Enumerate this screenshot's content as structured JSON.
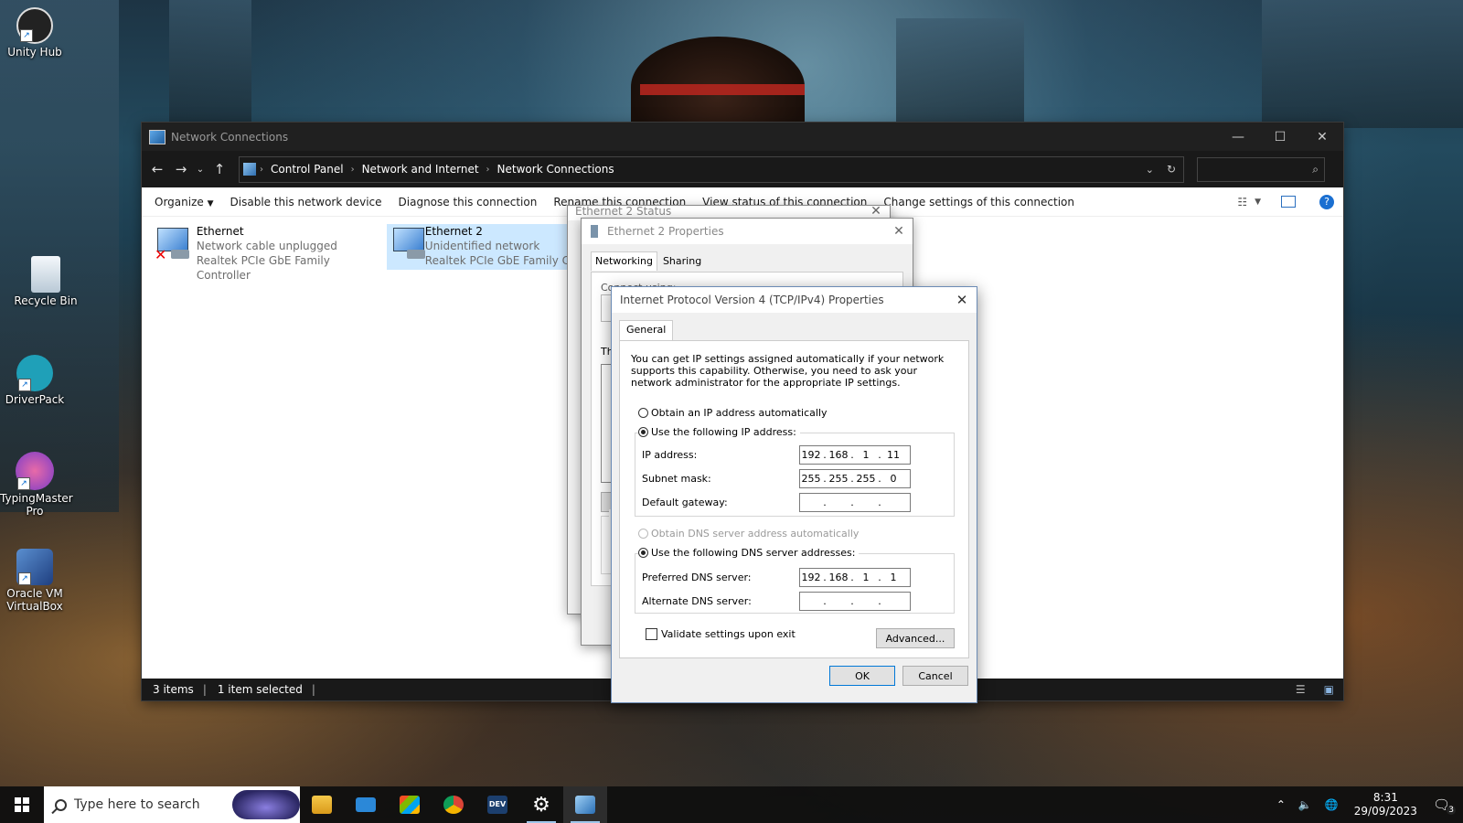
{
  "desktop": {
    "icons": [
      {
        "label": "Unity Hub"
      },
      {
        "label": "Recycle Bin"
      },
      {
        "label": "DriverPack"
      },
      {
        "label": "TypingMaster Pro"
      },
      {
        "label": "Oracle VM VirtualBox"
      }
    ]
  },
  "explorer": {
    "title": "Network Connections",
    "breadcrumb": [
      "Control Panel",
      "Network and Internet",
      "Network Connections"
    ],
    "commands": [
      "Organize",
      "Disable this network device",
      "Diagnose this connection",
      "Rename this connection",
      "View status of this connection",
      "Change settings of this connection"
    ],
    "items": [
      {
        "name": "Ethernet",
        "status": "Network cable unplugged",
        "adapter": "Realtek PCIe GbE Family Controller"
      },
      {
        "name": "Ethernet 2",
        "status": "Unidentified network",
        "adapter": "Realtek PCIe GbE Family C"
      }
    ],
    "status_bar": {
      "count": "3 items",
      "selected": "1 item selected"
    }
  },
  "status_dialog": {
    "title": "Ethernet 2 Status"
  },
  "properties_dialog": {
    "title": "Ethernet 2 Properties",
    "tabs": [
      "Networking",
      "Sharing"
    ],
    "connect_using_label": "Connect using:",
    "partial_text_1": "Th",
    "partial_text_2": "D"
  },
  "tcp_dialog": {
    "title": "Internet Protocol Version 4 (TCP/IPv4) Properties",
    "tab": "General",
    "description": "You can get IP settings assigned automatically if your network supports this capability. Otherwise, you need to ask your network administrator for the appropriate IP settings.",
    "ip_auto_label": "Obtain an IP address automatically",
    "ip_manual_label": "Use the following IP address:",
    "ip_mode": "manual",
    "fields": {
      "ip_address": {
        "label": "IP address:",
        "octets": [
          "192",
          "168",
          "1",
          "11"
        ]
      },
      "subnet_mask": {
        "label": "Subnet mask:",
        "octets": [
          "255",
          "255",
          "255",
          "0"
        ]
      },
      "default_gateway": {
        "label": "Default gateway:",
        "octets": [
          "",
          "",
          "",
          ""
        ]
      }
    },
    "dns_auto_label": "Obtain DNS server address automatically",
    "dns_manual_label": "Use the following DNS server addresses:",
    "dns_mode": "manual",
    "dns_fields": {
      "preferred": {
        "label": "Preferred DNS server:",
        "octets": [
          "192",
          "168",
          "1",
          "1"
        ]
      },
      "alternate": {
        "label": "Alternate DNS server:",
        "octets": [
          "",
          "",
          "",
          ""
        ]
      }
    },
    "validate_label": "Validate settings upon exit",
    "validate_checked": false,
    "advanced_label": "Advanced...",
    "ok_label": "OK",
    "cancel_label": "Cancel"
  },
  "taskbar": {
    "search_placeholder": "Type here to search",
    "apps": [
      "file-explorer",
      "mail",
      "microsoft-store",
      "chrome",
      "dev-home",
      "settings",
      "network-connections"
    ],
    "dev_label": "DEV",
    "time": "8:31",
    "date": "29/09/2023",
    "notification_count": "3"
  },
  "colors": {
    "accent": "#0078d7",
    "selection": "#cce8ff",
    "dark_chrome": "#191919"
  }
}
